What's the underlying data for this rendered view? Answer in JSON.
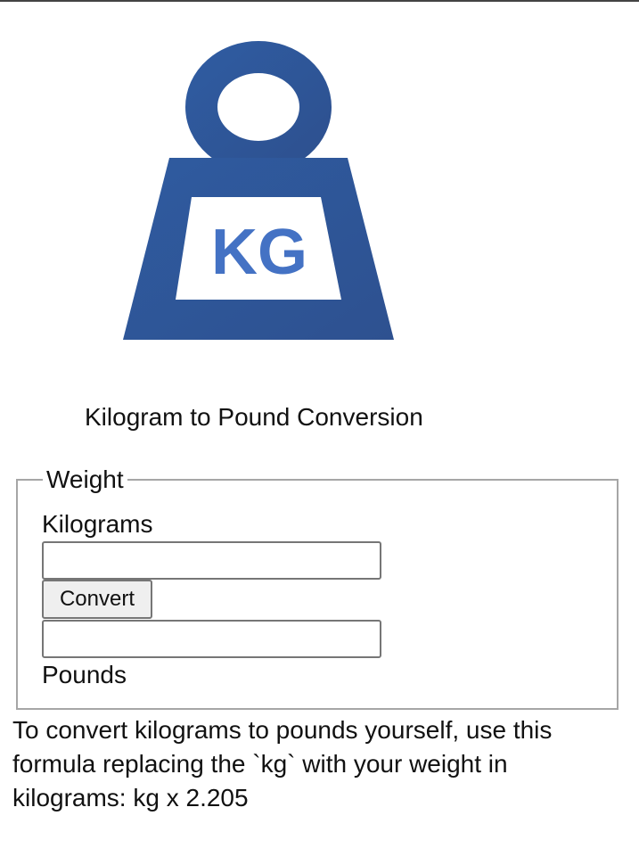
{
  "logo": {
    "text": "KG",
    "icon": "kilogram-weight-icon",
    "colors": {
      "weight": "#2f5597",
      "label_bg": "#ffffff",
      "text": "#4472c4"
    }
  },
  "page": {
    "title": "Kilogram to Pound Conversion"
  },
  "form": {
    "legend": "Weight",
    "kilograms_label": "Kilograms",
    "kilograms_value": "",
    "convert_label": "Convert",
    "pounds_value": "",
    "pounds_label": "Pounds"
  },
  "formula_text": "To convert kilograms to pounds yourself, use this formula replacing the `kg` with your weight in kilograms: kg x 2.205"
}
